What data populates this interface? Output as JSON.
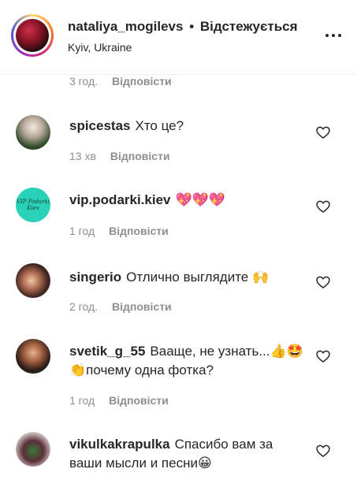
{
  "header": {
    "username": "nataliya_mogilevs",
    "separator": "•",
    "follow_status": "Відстежується",
    "location": "Kyiv, Ukraine",
    "more_icon": "more-horizontal-icon"
  },
  "top_meta": {
    "time": "3 год.",
    "reply": "Відповісти"
  },
  "comments": [
    {
      "user": "spicestas",
      "text": "Хто це?",
      "time": "13 хв",
      "reply": "Відповісти"
    },
    {
      "user": "vip.podarki.kiev",
      "text": "💖💖💖",
      "time": "1 год",
      "reply": "Відповісти",
      "avatar_text": "VIP Podarki Kiev"
    },
    {
      "user": "singerio",
      "text": "Отлично выглядите 🙌",
      "time": "2 год.",
      "reply": "Відповісти"
    },
    {
      "user": "svetik_g_55",
      "text": "Вааще, не узнать...👍🤩👏почему одна фотка?",
      "time": "1 год",
      "reply": "Відповісти"
    },
    {
      "user": "vikulkakrapulka",
      "text": "Спасибо вам за ваши мысли и песни😀",
      "time": "",
      "reply": ""
    }
  ],
  "colors": {
    "text": "#262626",
    "muted": "#8e8e8e",
    "divider": "#efefef"
  },
  "icons": {
    "like": "heart-outline-icon"
  }
}
